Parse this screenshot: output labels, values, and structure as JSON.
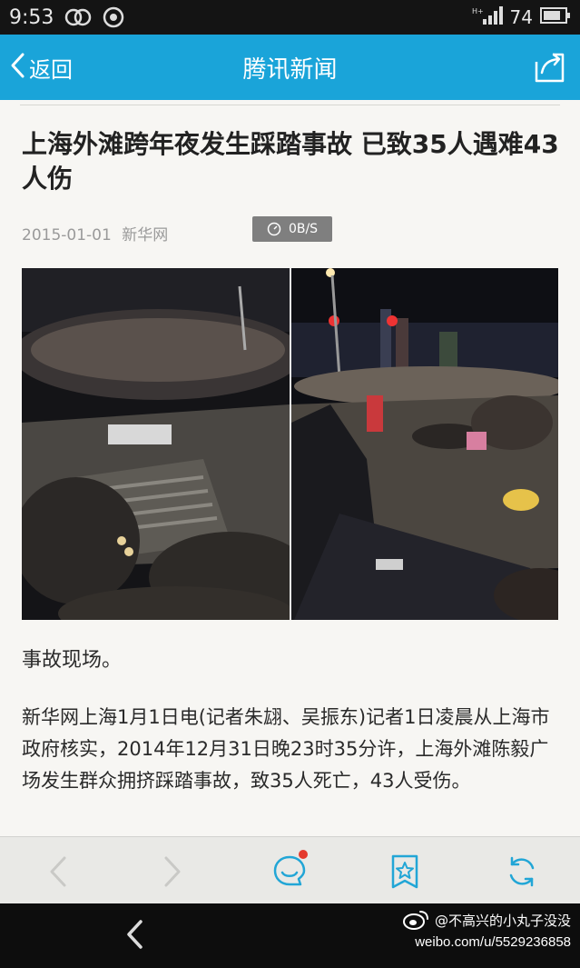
{
  "status_bar": {
    "time": "9:53",
    "battery_percent": "74",
    "icons": [
      "circles-icon",
      "camera-shutter-icon",
      "signal-icon",
      "battery-icon"
    ]
  },
  "app_bar": {
    "back_label": "返回",
    "title": "腾讯新闻",
    "accent": "#1aa4d9"
  },
  "article": {
    "headline": "上海外滩跨年夜发生踩踏事故 已致35人遇难43人伤",
    "date": "2015-01-01",
    "source": "新华网",
    "speed_badge": "0B/S",
    "caption": "事故现场。",
    "body": "新华网上海1月1日电(记者朱翃、吴振东)记者1日凌晨从上海市政府核实，2014年12月31日晚23时35分许，上海外滩陈毅广场发生群众拥挤踩踏事故，致35人死亡，43人受伤。"
  },
  "toolbar": {
    "icons": [
      "prev-arrow-icon",
      "next-arrow-icon",
      "comment-icon",
      "bookmark-star-icon",
      "refresh-icon"
    ],
    "comment_badge_color": "#e4392c"
  },
  "watermark": {
    "handle": "@不高兴的小丸子没没",
    "url": "weibo.com/u/5529236858"
  }
}
